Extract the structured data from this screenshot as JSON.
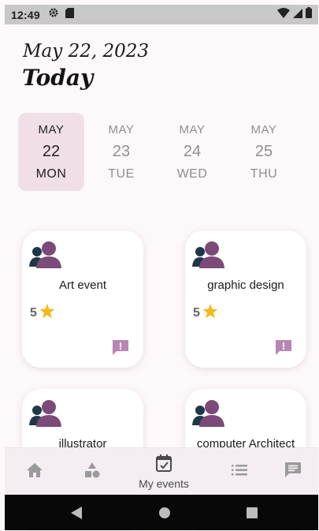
{
  "status_bar": {
    "time": "12:49",
    "icons": [
      "settings-icon",
      "sd-card-icon",
      "wifi-icon",
      "signal-icon",
      "battery-icon"
    ]
  },
  "header": {
    "date": "May 22, 2023",
    "today": "Today"
  },
  "day_picker": {
    "days": [
      {
        "month": "MAY",
        "day": "22",
        "weekday": "MON",
        "selected": true
      },
      {
        "month": "MAY",
        "day": "23",
        "weekday": "TUE",
        "selected": false
      },
      {
        "month": "MAY",
        "day": "24",
        "weekday": "WED",
        "selected": false
      },
      {
        "month": "MAY",
        "day": "25",
        "weekday": "THU",
        "selected": false
      }
    ]
  },
  "events": [
    {
      "title": "Art event",
      "rating": "5"
    },
    {
      "title": "graphic design",
      "rating": "5"
    },
    {
      "title": "illustrator"
    },
    {
      "title": "computer Architect"
    }
  ],
  "bottom_nav": {
    "items": [
      {
        "icon": "home-icon"
      },
      {
        "icon": "category-icon"
      },
      {
        "icon": "calendar-check-icon",
        "label": "My events",
        "active": true
      },
      {
        "icon": "list-icon"
      },
      {
        "icon": "message-icon"
      }
    ]
  },
  "colors": {
    "accent": "#7c4a78",
    "avatar_dark": "#1f3847",
    "star": "#f5b719",
    "selected_day_bg": "#f1dfe8",
    "chat_icon": "#b886b4"
  }
}
